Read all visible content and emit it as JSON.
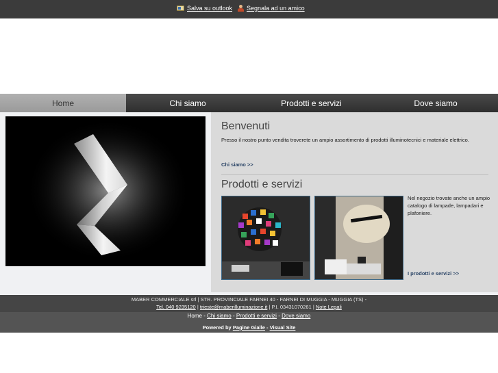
{
  "topbar": {
    "outlook_label": "Salva su outlook",
    "friend_label": "Segnala ad un amico"
  },
  "nav": {
    "items": [
      {
        "label": "Home"
      },
      {
        "label": "Chi siamo"
      },
      {
        "label": "Prodotti e servizi"
      },
      {
        "label": "Dove siamo"
      }
    ],
    "active_index": 0
  },
  "welcome": {
    "title": "Benvenuti",
    "text": "Presso il nostro punto vendita troverete un ampio assortimento di prodotti illuminotecnici e materiale elettrico.",
    "more_label": "Chi siamo >>"
  },
  "products": {
    "title": "Prodotti e servizi",
    "text": "Nel negozio trovate anche un ampio catalogo di lampade, lampadari e plafoniere.",
    "more_label": "I prodotti e servizi >>"
  },
  "footer": {
    "company": "MABER COMMERCIALE srl | STR. PROVINCIALE FARNEI 40 - FARNEI DI MUGGIA - MUGGIA (TS) -",
    "phone": "Tel. 040 9235120",
    "email": "trieste@maberilluminazione.it",
    "vat": "P.I. 03431070261",
    "legal": "Note Legali",
    "nav_links": [
      "Home",
      "Chi siamo",
      "Prodotti e servizi",
      "Dove siamo"
    ],
    "powered_prefix": "Powered by",
    "powered_pg": "Pagine Gialle",
    "powered_vs": "Visual Site"
  },
  "colors": {
    "topbar": "#3b3b3b",
    "nav_active": "#a6a6a6",
    "panel": "#dadada",
    "link": "#2a4466"
  }
}
